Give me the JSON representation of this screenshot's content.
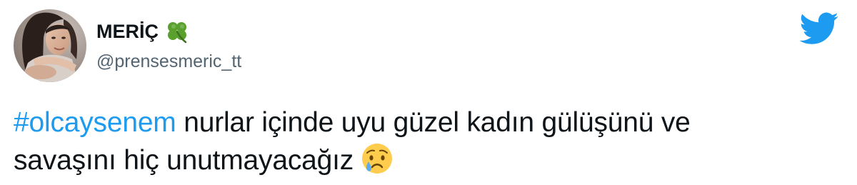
{
  "tweet": {
    "author": {
      "display_name": "MERİÇ",
      "name_emoji": "four-leaf-clover",
      "handle": "@prensesmeric_tt",
      "avatar": "profile-photo"
    },
    "brand_icon": "twitter-bird-icon",
    "body": {
      "hashtag": "#olcaysenem",
      "line1_rest": " nurlar içinde uyu güzel kadın gülüşünü ve",
      "line2": "savaşını hiç unutmayacağız",
      "trailing_emoji": "crying-face"
    }
  },
  "colors": {
    "twitter_blue": "#1d9bf0",
    "text_primary": "#0f1419",
    "text_secondary": "#536471",
    "clover_green": "#5aa02c"
  }
}
